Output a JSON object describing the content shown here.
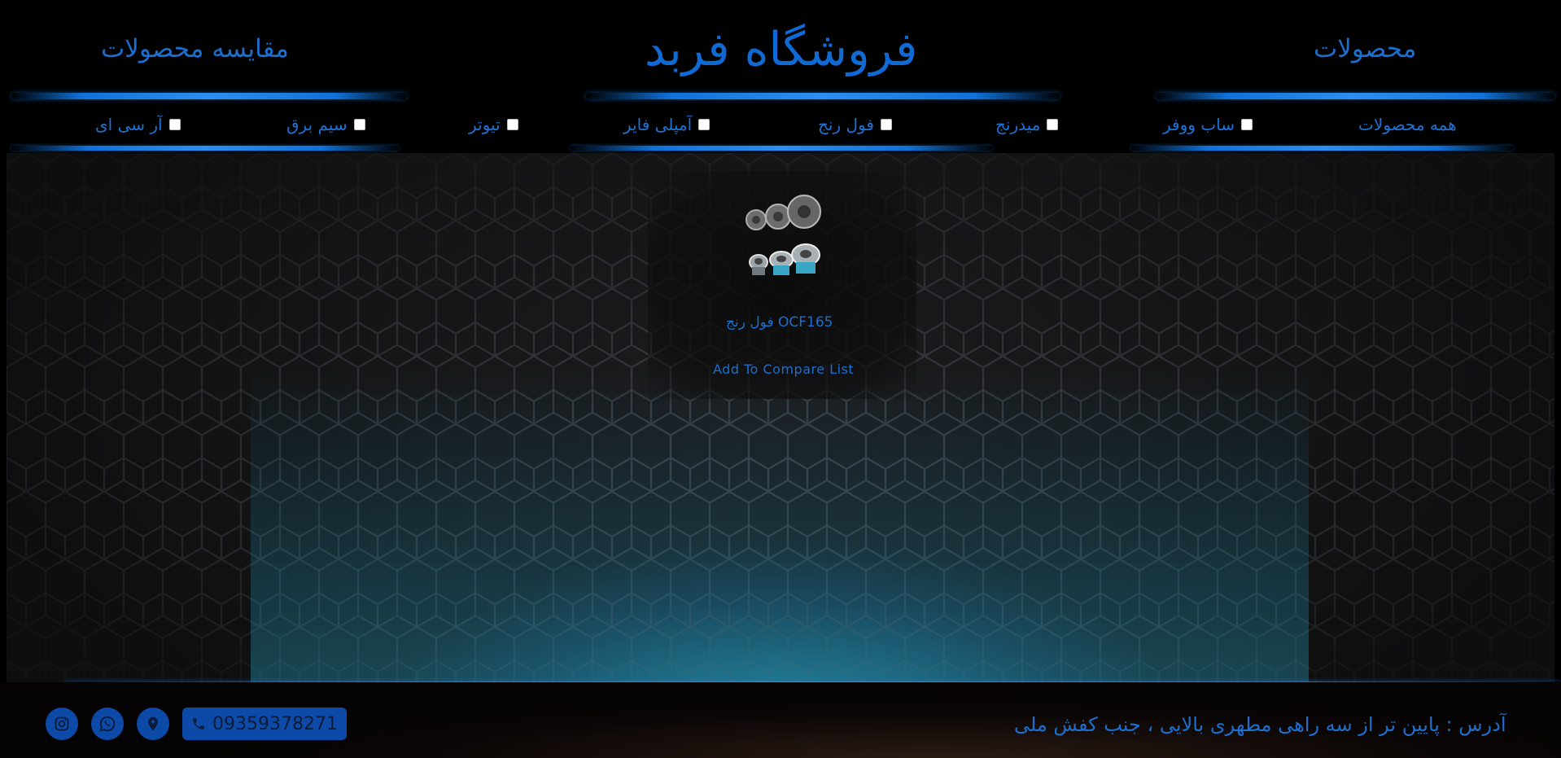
{
  "header": {
    "title": "فروشگاه فربد",
    "products_link": "محصولات",
    "compare_link": "مقایسه محصولات"
  },
  "filters": [
    {
      "label": "همه محصولات",
      "checkbox": false
    },
    {
      "label": "ساب ووفر",
      "checkbox": true
    },
    {
      "label": "میدرنج",
      "checkbox": true
    },
    {
      "label": "فول رنج",
      "checkbox": true
    },
    {
      "label": "آمپلی فایر",
      "checkbox": true
    },
    {
      "label": "تیوتر",
      "checkbox": true
    },
    {
      "label": "سیم برق",
      "checkbox": true
    },
    {
      "label": "آر سی ای",
      "checkbox": true
    }
  ],
  "product": {
    "title": "فول رنج OCF165",
    "compare_label": "Add To Compare List"
  },
  "footer": {
    "address": "آدرس : پایین تر از سه راهی مطهری بالایی ، جنب کفش ملی",
    "phone": "09359378271"
  },
  "colors": {
    "accent": "#0f6ad6",
    "button_bg": "#0d4aa8",
    "background": "#000000"
  },
  "icons": [
    "phone-icon",
    "location-icon",
    "whatsapp-icon",
    "instagram-icon"
  ]
}
